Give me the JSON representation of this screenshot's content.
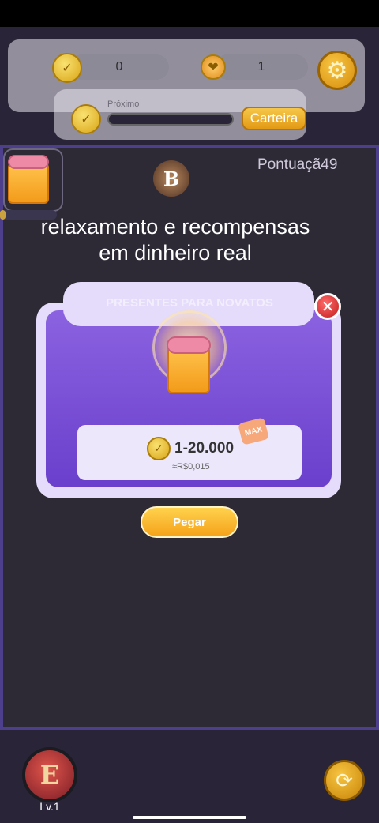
{
  "hud": {
    "coins_value": "0",
    "gems_value": "1",
    "progress_label": "Próximo",
    "progress_value": 0.0,
    "wallet_label": "Carteira"
  },
  "board": {
    "score_text": "Pontuaçã49",
    "chip_letter": "B",
    "progress_value": 0.1
  },
  "overlay_text": "relaxamento e recompensas em dinheiro real",
  "modal": {
    "title": "PRESENTES PARA NOVATOS",
    "close_glyph": "✕",
    "reward_amount": "1-20.000",
    "reward_value": "≈R$0,015",
    "max_tag": "MAX",
    "claim_label": "Pegar"
  },
  "player": {
    "avatar_letter": "E",
    "level": "Lv.1"
  },
  "colors": {
    "board_border": "#4e3f8d",
    "modal_purple": "#7a4fd6",
    "gold": "#f5a21a",
    "close_red": "#d22a2a"
  }
}
